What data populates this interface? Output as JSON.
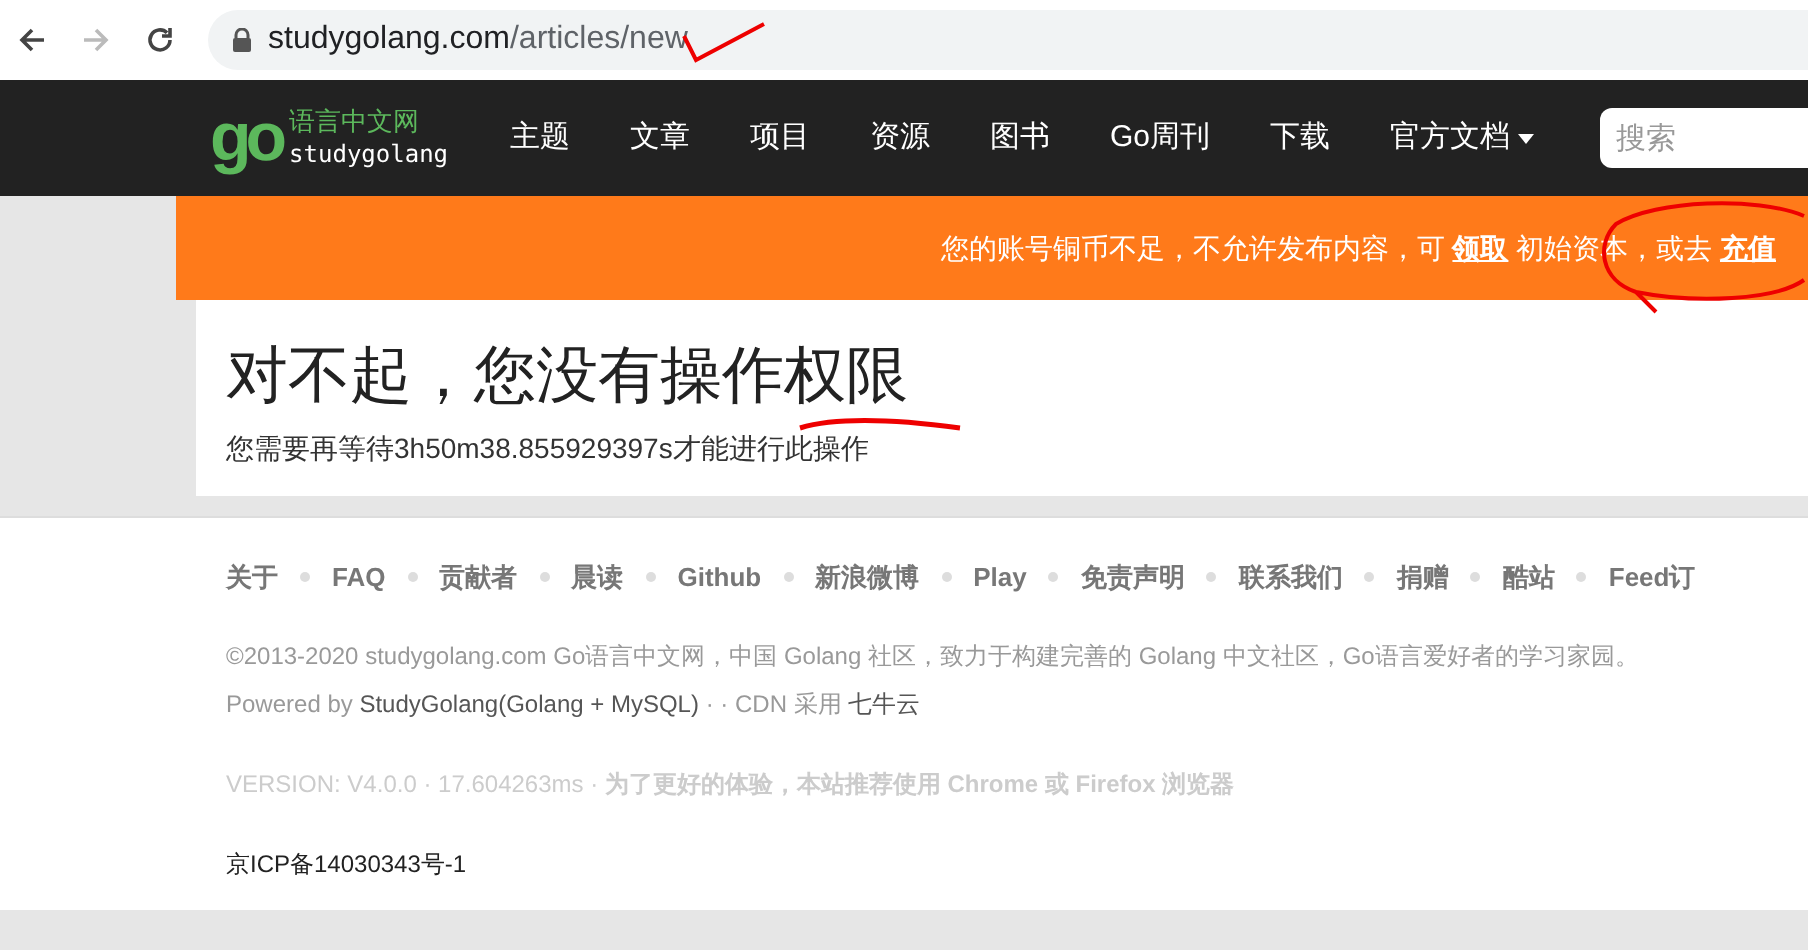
{
  "browser": {
    "url_host": "studygolang.com",
    "url_path": "/articles/new"
  },
  "logo": {
    "mark": "go",
    "name_cn": "语言中文网",
    "name_en": "studygolang"
  },
  "nav": [
    {
      "label": "主题",
      "dropdown": false
    },
    {
      "label": "文章",
      "dropdown": false
    },
    {
      "label": "项目",
      "dropdown": false
    },
    {
      "label": "资源",
      "dropdown": false
    },
    {
      "label": "图书",
      "dropdown": false
    },
    {
      "label": "Go周刊",
      "dropdown": false
    },
    {
      "label": "下载",
      "dropdown": false
    },
    {
      "label": "官方文档",
      "dropdown": true
    }
  ],
  "search": {
    "placeholder": "搜索"
  },
  "notice": {
    "text_1": "您的账号铜币不足，不允许发布内容，可",
    "link_1": "领取",
    "text_2": "初始资本，或去",
    "link_2": "充值"
  },
  "error": {
    "title": "对不起，您没有操作权限",
    "message": "您需要再等待3h50m38.855929397s才能进行此操作"
  },
  "footer": {
    "links": [
      "关于",
      "FAQ",
      "贡献者",
      "晨读",
      "Github",
      "新浪微博",
      "Play",
      "免责声明",
      "联系我们",
      "捐赠",
      "酷站",
      "Feed订"
    ],
    "copyright": "©2013-2020 studygolang.com Go语言中文网，中国 Golang 社区，致力于构建完善的 Golang 中文社区，Go语言爱好者的学习家园。",
    "powered_label": "Powered by",
    "powered_link": "StudyGolang(Golang + MySQL)",
    "cdn_label": "· · CDN 采用",
    "cdn_link": "七牛云",
    "version": "VERSION: V4.0.0 · 17.604263ms · **为了更好的体验，本站推荐使用 Chrome 或 Firefox 浏览器**",
    "icp": "京ICP备14030343号-1"
  }
}
